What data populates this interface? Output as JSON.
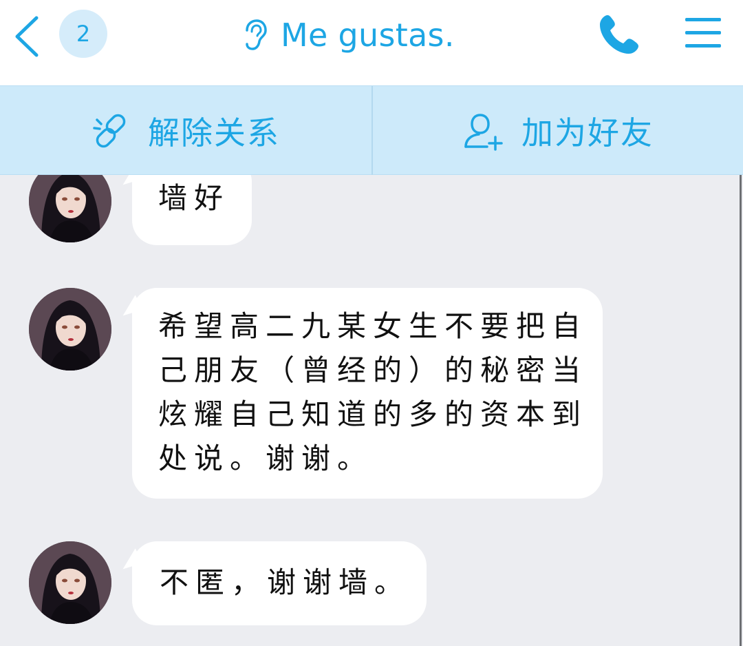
{
  "header": {
    "back_icon": "chevron-left-icon",
    "unread_badge": "2",
    "title_icon": "ear-icon",
    "title": "Me gustas.",
    "call_icon": "phone-icon",
    "menu_icon": "hamburger-menu-icon"
  },
  "action_bar": {
    "actions": [
      {
        "icon": "broken-link-icon",
        "label": "解除关系"
      },
      {
        "icon": "add-friend-icon",
        "label": "加为好友"
      }
    ]
  },
  "messages": [
    {
      "sender": "avatar",
      "text": "墙好"
    },
    {
      "sender": "avatar",
      "text": "希望高二九某女生不要把自己朋友（曾经的）的秘密当炫耀自己知道的多的资本到处说。谢谢。"
    },
    {
      "sender": "avatar",
      "text": "不匿，谢谢墙。"
    }
  ],
  "colors": {
    "accent": "#1da6e4",
    "action_bar_bg": "#cdeafa",
    "chat_bg": "#ecedf1",
    "bubble_bg": "#ffffff"
  }
}
